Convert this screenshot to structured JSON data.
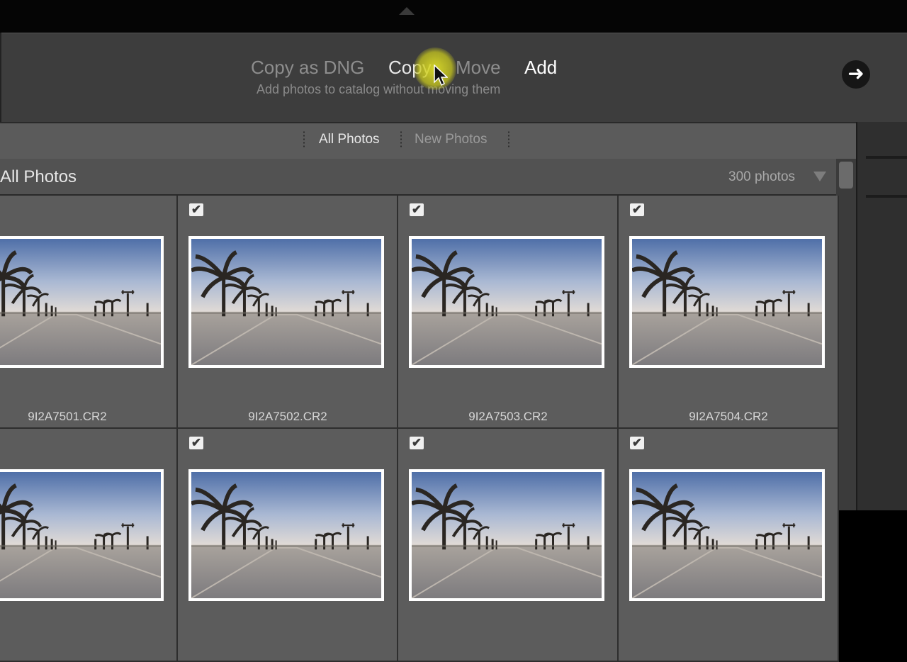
{
  "import_modes": {
    "copy_as_dng": "Copy as DNG",
    "copy": "Copy",
    "move": "Move",
    "add": "Add",
    "description": "Add photos to catalog without moving them"
  },
  "next_button": {
    "icon": "arrow-right-icon"
  },
  "toolbar": {
    "tabs": [
      {
        "label": "All Photos",
        "active": true
      },
      {
        "label": "New Photos",
        "active": false
      }
    ]
  },
  "section": {
    "title": "All Photos",
    "count": "300 photos"
  },
  "photos": [
    {
      "filename": "9I2A7501.CR2",
      "checked": true
    },
    {
      "filename": "9I2A7502.CR2",
      "checked": true
    },
    {
      "filename": "9I2A7503.CR2",
      "checked": true
    },
    {
      "filename": "9I2A7504.CR2",
      "checked": true
    },
    {
      "filename": "",
      "checked": true
    },
    {
      "filename": "",
      "checked": true
    },
    {
      "filename": "",
      "checked": true
    },
    {
      "filename": "",
      "checked": true
    }
  ]
}
